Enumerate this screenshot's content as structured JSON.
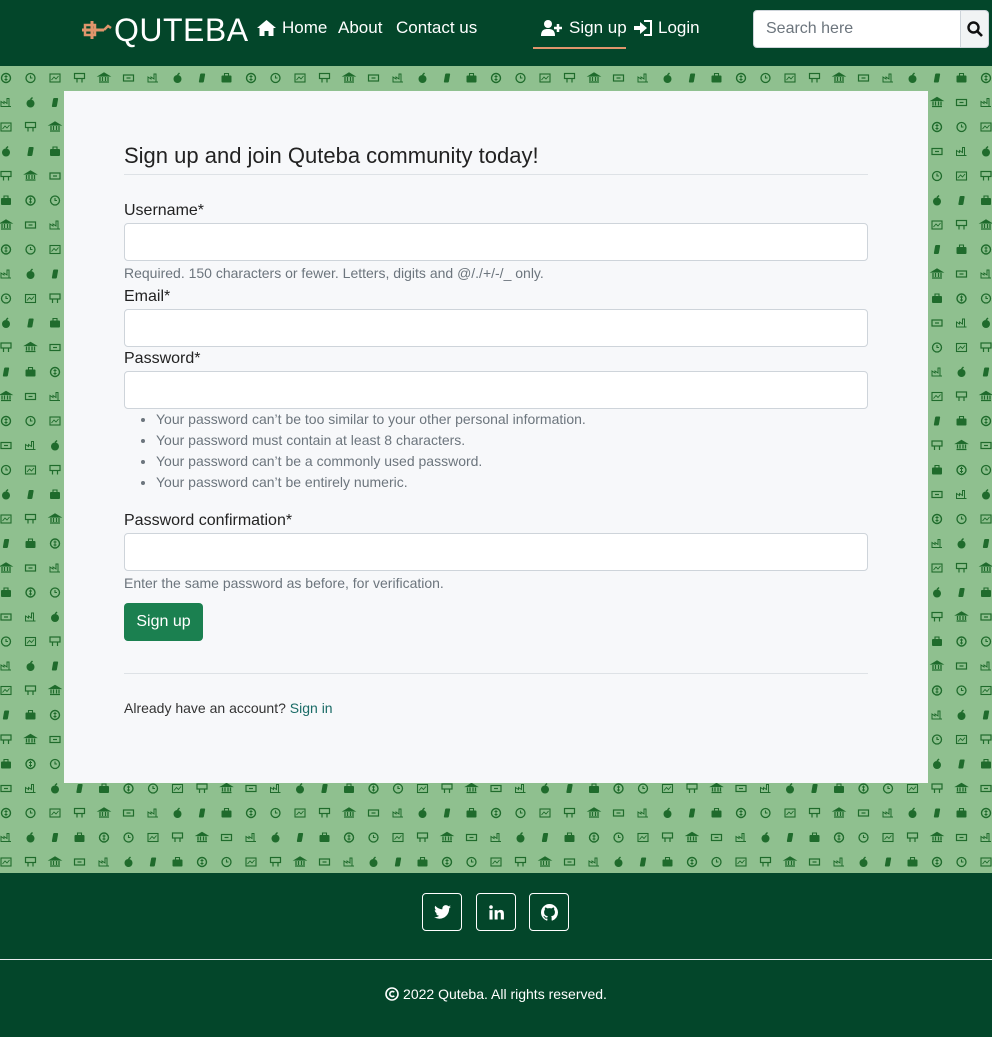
{
  "navbar": {
    "brand": "QUTEBA",
    "links": {
      "home": "Home",
      "about": "About",
      "contact": "Contact us",
      "signup": "Sign up",
      "login": "Login"
    },
    "search_placeholder": "Search here"
  },
  "form": {
    "title": "Sign up and join Quteba community today!",
    "username_label": "Username*",
    "username_help": "Required. 150 characters or fewer. Letters, digits and @/./+/-/_ only.",
    "email_label": "Email*",
    "password_label": "Password*",
    "password_rules": [
      "Your password can’t be too similar to your other personal information.",
      "Your password must contain at least 8 characters.",
      "Your password can’t be a commonly used password.",
      "Your password can’t be entirely numeric."
    ],
    "password2_label": "Password confirmation*",
    "password2_help": "Enter the same password as before, for verification.",
    "submit_label": "Sign up",
    "account_prompt": "Already have an account?",
    "signin_link": "Sign in"
  },
  "footer": {
    "copyright": "2022 Quteba. All rights reserved."
  },
  "colors": {
    "navbar_bg": "#03462a",
    "accent": "#e0956c",
    "pattern_bg": "#8fc08f",
    "button": "#1b8050"
  }
}
